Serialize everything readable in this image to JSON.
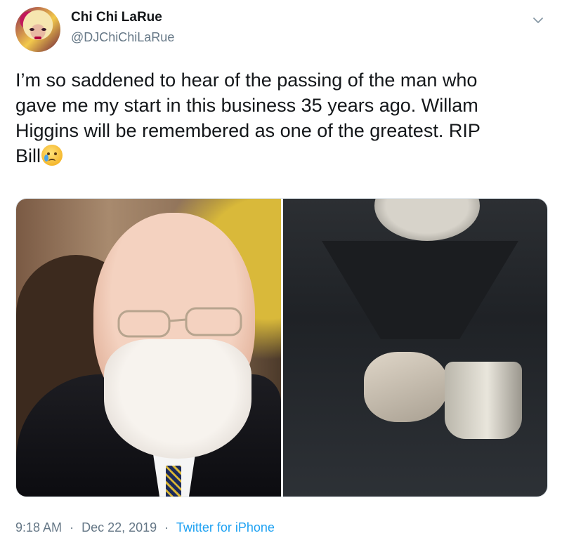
{
  "author": {
    "display_name": "Chi Chi LaRue",
    "handle": "@DJChiChiLaRue",
    "avatar": "avatar-photo"
  },
  "menu_icon": "chevron-down-icon",
  "tweet": {
    "text_line_1": "I’m so saddened to hear of the passing of the man who",
    "text_line_2": "gave me my start in this business 35 years ago. Willam",
    "text_line_3": "Higgins will be remembered as one of the greatest. RIP",
    "text_line_4": "Bill",
    "emoji": "crying-face-emoji"
  },
  "media": {
    "photos": [
      "photo-bald-man-with-glasses-and-beard",
      "photo-man-holding-mug"
    ]
  },
  "meta": {
    "time": "9:18 AM",
    "separator": "·",
    "date": "Dec 22, 2019",
    "source": "Twitter for iPhone"
  },
  "colors": {
    "text": "#14171a",
    "secondary": "#657786",
    "link": "#1da1f2"
  }
}
